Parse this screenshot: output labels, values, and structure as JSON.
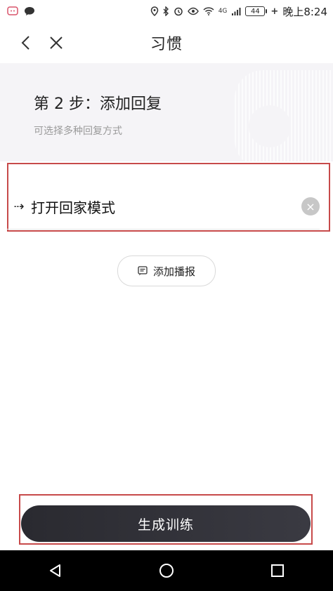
{
  "status_bar": {
    "time": "晚上8:24",
    "battery": "44",
    "network": "4G"
  },
  "header": {
    "title": "习惯"
  },
  "step": {
    "title": "第 2 步：添加回复",
    "subtitle": "可选择多种回复方式"
  },
  "reply": {
    "arrow": "⇢",
    "value": "打开回家模式",
    "clear": "×"
  },
  "add_broadcast": {
    "label": "添加播报"
  },
  "generate": {
    "label": "生成训练"
  }
}
